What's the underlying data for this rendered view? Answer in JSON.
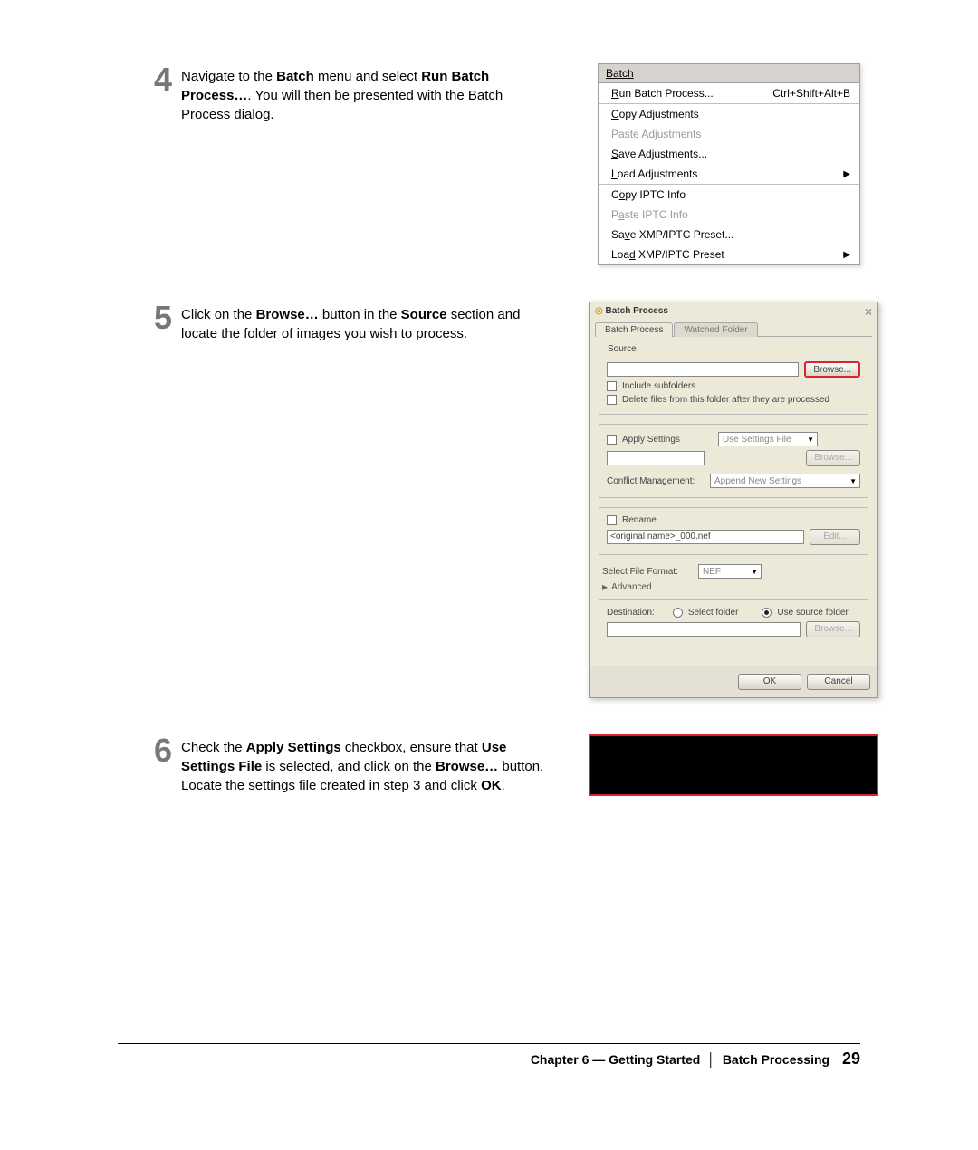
{
  "steps": {
    "s4": {
      "num": "4",
      "pre1": "Navigate to the ",
      "bold1": "Batch",
      "mid1": " menu and select ",
      "bold2": "Run Batch Process…",
      "post1": ". You will then be presented with the Batch Process dialog."
    },
    "s5": {
      "num": "5",
      "pre1": "Click on the ",
      "bold1": "Browse…",
      "mid1": " button in the ",
      "bold2": "Source",
      "post1": " section and locate the folder of images you wish to process."
    },
    "s6": {
      "num": "6",
      "pre1": "Check the ",
      "bold1": "Apply Settings",
      "mid1": " checkbox, ensure that ",
      "bold2": "Use Settings File",
      "mid2": " is selected, and click on the ",
      "bold3": "Browse…",
      "mid3": " button. Locate the settings file created in step 3 and click ",
      "bold4": "OK",
      "post1": "."
    }
  },
  "menu": {
    "title": "Batch",
    "items": {
      "run": {
        "pre": "",
        "u": "R",
        "post": "un Batch Process...",
        "shortcut": "Ctrl+Shift+Alt+B",
        "disabled": false,
        "arrow": false
      },
      "copyAdj": {
        "pre": "",
        "u": "C",
        "post": "opy Adjustments",
        "shortcut": "",
        "disabled": false,
        "arrow": false
      },
      "pasteAdj": {
        "pre": "",
        "u": "P",
        "post": "aste Adjustments",
        "shortcut": "",
        "disabled": true,
        "arrow": false
      },
      "saveAdj": {
        "pre": "",
        "u": "S",
        "post": "ave Adjustments...",
        "shortcut": "",
        "disabled": false,
        "arrow": false
      },
      "loadAdj": {
        "pre": "",
        "u": "L",
        "post": "oad Adjustments",
        "shortcut": "",
        "disabled": false,
        "arrow": true
      },
      "copyIptc": {
        "pre": "C",
        "u": "o",
        "post": "py IPTC Info",
        "shortcut": "",
        "disabled": false,
        "arrow": false
      },
      "pasteIptc": {
        "pre": "P",
        "u": "a",
        "post": "ste IPTC Info",
        "shortcut": "",
        "disabled": true,
        "arrow": false
      },
      "saveXmp": {
        "pre": "Sa",
        "u": "v",
        "post": "e XMP/IPTC Preset...",
        "shortcut": "",
        "disabled": false,
        "arrow": false
      },
      "loadXmp": {
        "pre": "Loa",
        "u": "d",
        "post": " XMP/IPTC Preset",
        "shortcut": "",
        "disabled": false,
        "arrow": true
      }
    }
  },
  "dialog": {
    "title": "Batch Process",
    "tab1": "Batch Process",
    "tab2": "Watched Folder",
    "source_label": "Source",
    "btn_browse": "Browse...",
    "chk_subfolders": "Include subfolders",
    "chk_deleteafter": "Delete files from this folder after they are processed",
    "apply_settings": "Apply Settings",
    "use_settings_file": "Use Settings File",
    "conflict_label": "Conflict Management:",
    "conflict_value": "Append New Settings",
    "rename_label": "Rename",
    "rename_pattern": "<original name>_000.nef",
    "btn_edit": "Edit...",
    "fileformat_label": "Select File Format:",
    "fileformat_value": "NEF",
    "advanced": "Advanced",
    "destination_label": "Destination:",
    "radio_select_folder": "Select folder",
    "radio_use_source": "Use source folder",
    "btn_ok": "OK",
    "btn_cancel": "Cancel"
  },
  "footer": {
    "chapter": "Chapter 6 — Getting Started",
    "section": "Batch Processing",
    "pagenum": "29"
  }
}
